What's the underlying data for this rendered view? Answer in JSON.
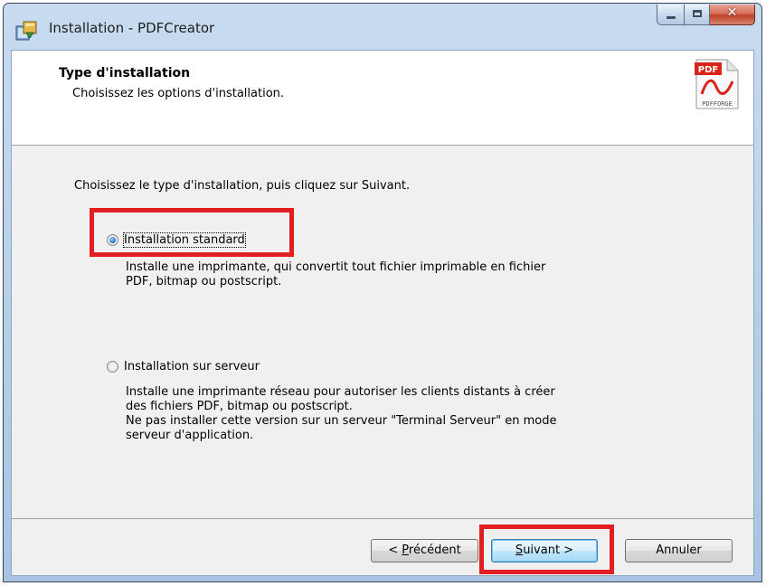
{
  "window": {
    "title": "Installation - PDFCreator",
    "caption": {
      "minimize": "minimize",
      "maximize": "maximize",
      "close": "✕"
    }
  },
  "header": {
    "title": "Type d'installation",
    "subtitle": "Choisissez les options d'installation.",
    "logo_top": "PDF",
    "logo_bottom": "PDFFORGE"
  },
  "main": {
    "prompt": "Choisissez le type d'installation, puis cliquez sur Suivant.",
    "options": [
      {
        "label": "Installation standard",
        "selected": true,
        "description_lines": [
          "Installe une imprimante, qui convertit tout fichier imprimable en fichier",
          "PDF, bitmap ou postscript."
        ]
      },
      {
        "label": "Installation sur serveur",
        "selected": false,
        "description_lines": [
          "Installe une imprimante réseau pour autoriser les clients distants à créer",
          "des fichiers PDF, bitmap ou postscript.",
          "Ne pas installer cette version sur un serveur \"Terminal Serveur\" en mode",
          "serveur d'application."
        ]
      }
    ]
  },
  "buttons": {
    "back_prefix": "< ",
    "back_accel": "P",
    "back_rest": "récédent",
    "next_accel": "S",
    "next_rest": "uivant >",
    "cancel": "Annuler"
  },
  "colors": {
    "highlight": "#e11e23",
    "window_frame": "#b9d1ea",
    "dialog_bg": "#f0f0f0"
  },
  "icons": {
    "app": "installer-icon",
    "logo": "pdf-forge-logo"
  }
}
